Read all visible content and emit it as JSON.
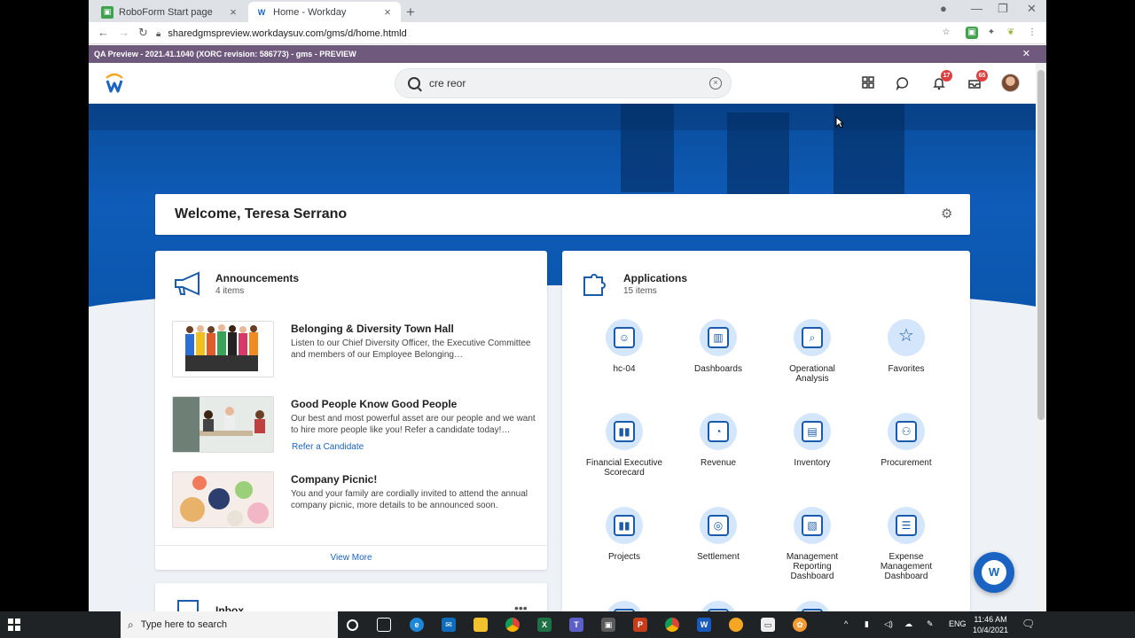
{
  "browser": {
    "tabs": [
      {
        "label": "RoboForm Start page",
        "active": false
      },
      {
        "label": "Home - Workday",
        "active": true
      }
    ],
    "url": "sharedgmspreview.workdaysuv.com/gms/d/home.htmld"
  },
  "banner": {
    "text": "QA Preview - 2021.41.1040 (XORC revision: 586773) - gms - PREVIEW"
  },
  "header": {
    "search_value": "cre reor",
    "notifications_count": "17",
    "inbox_count": "65"
  },
  "welcome": {
    "title": "Welcome, Teresa Serrano"
  },
  "announcements": {
    "title": "Announcements",
    "count": "4 items",
    "items": [
      {
        "title": "Belonging & Diversity Town Hall",
        "body": "Listen to our Chief Diversity Officer, the Executive Committee and members of our Employee Belonging…",
        "link": ""
      },
      {
        "title": "Good People Know Good People",
        "body": "Our best and most powerful asset are our people and we want to hire more people like you! Refer a candidate today!…",
        "link": "Refer a Candidate"
      },
      {
        "title": "Company Picnic!",
        "body": "You and your family are cordially invited to attend the annual company picnic, more details to be announced soon.",
        "link": ""
      }
    ],
    "view_more": "View More"
  },
  "inbox": {
    "title": "Inbox"
  },
  "applications": {
    "title": "Applications",
    "count": "15 items",
    "items": [
      {
        "label": "hc-04",
        "icon": "people-icon"
      },
      {
        "label": "Dashboards",
        "icon": "dashboard-icon"
      },
      {
        "label": "Operational Analysis",
        "icon": "magnifier-icon"
      },
      {
        "label": "Favorites",
        "icon": "star-icon"
      },
      {
        "label": "Financial Executive Scorecard",
        "icon": "chart-board-icon"
      },
      {
        "label": "Revenue",
        "icon": "pie-board-icon"
      },
      {
        "label": "Inventory",
        "icon": "box-icon"
      },
      {
        "label": "Procurement",
        "icon": "procurement-icon"
      },
      {
        "label": "Projects",
        "icon": "project-board-icon"
      },
      {
        "label": "Settlement",
        "icon": "coins-icon"
      },
      {
        "label": "Management Reporting Dashboard",
        "icon": "report-icon"
      },
      {
        "label": "Expense Management Dashboard",
        "icon": "expense-icon"
      }
    ]
  },
  "taskbar": {
    "search_placeholder": "Type here to search",
    "lang": "ENG",
    "time": "11:46 AM",
    "date": "10/4/2021"
  },
  "colors": {
    "brand_blue": "#1a63c2",
    "banner_purple": "#6f5a7e",
    "badge_red": "#de4040"
  }
}
